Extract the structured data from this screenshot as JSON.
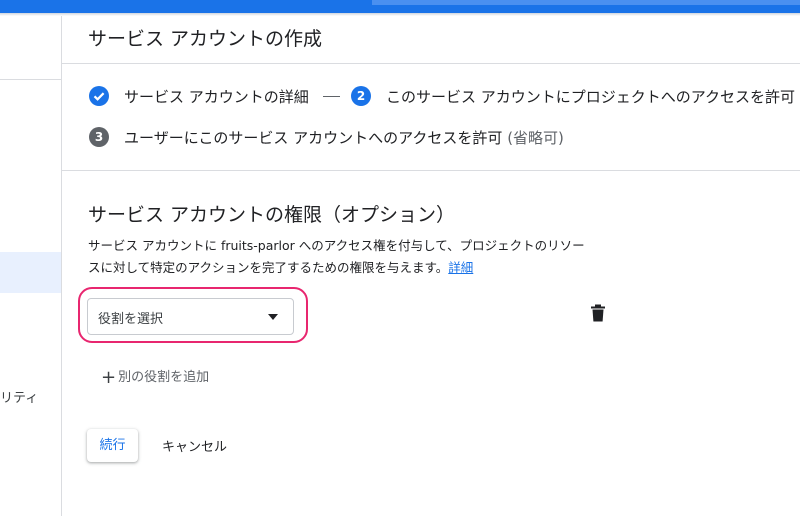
{
  "colors": {
    "primary": "#1a73e8",
    "highlight": "#e8266f",
    "inactive_step": "#5f6368"
  },
  "sidebar": {
    "partial_item_text": "リティ"
  },
  "page": {
    "title": "サービス アカウントの作成"
  },
  "steps": [
    {
      "icon": "check-icon",
      "label": "サービス アカウントの詳細",
      "state": "done"
    },
    {
      "number": "2",
      "label": "このサービス アカウントにプロジェクトへのアクセスを許可",
      "state": "active"
    },
    {
      "number": "3",
      "label": "ユーザーにこのサービス アカウントへのアクセスを許可",
      "optional": "(省略可)",
      "state": "pending"
    }
  ],
  "permissions": {
    "title": "サービス アカウントの権限（オプション）",
    "description_line1": "サービス アカウントに fruits-parlor へのアクセス権を付与して、プロジェクトのリソー",
    "description_line2": "スに対して特定のアクションを完了するための権限を与えます。",
    "details_link": "詳細",
    "role_placeholder": "役割を選択",
    "add_role_label": "別の役割を追加",
    "delete_icon": "trash-icon"
  },
  "actions": {
    "continue_label": "続行",
    "cancel_label": "キャンセル"
  }
}
